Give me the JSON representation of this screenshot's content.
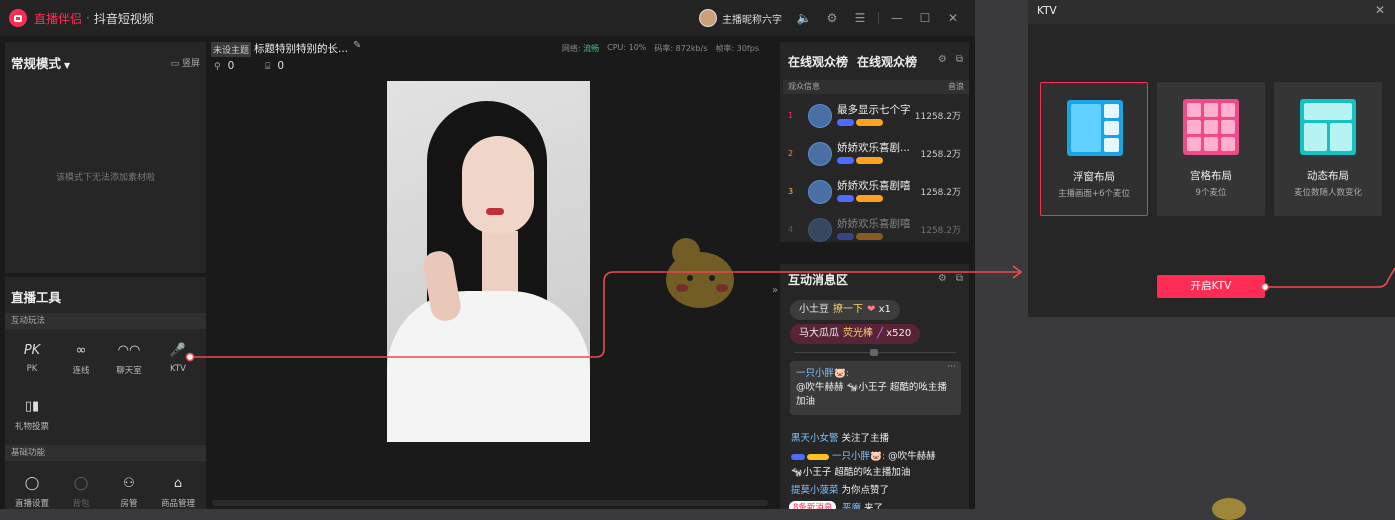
{
  "titlebar": {
    "brand": "直播伴侣",
    "sep": "·",
    "subtitle": "抖音短视频",
    "host_name": "主播昵称六字"
  },
  "left": {
    "mode_title": "常规模式",
    "screen_btn": "竖屏",
    "empty_msg": "该模式下无法添加素材啦",
    "tools_title": "直播工具",
    "sec_interactive": "互动玩法",
    "sec_basic": "基础功能",
    "tools": {
      "pk": "PK",
      "link": "连线",
      "chat": "聊天室",
      "ktv": "KTV",
      "vote": "礼物投票",
      "settings": "直播设置",
      "bag": "背包",
      "admin": "房管",
      "goods": "商品管理"
    }
  },
  "stream": {
    "tag": "未设主题",
    "title": "标题特别特别的长...",
    "net_label": "网络:",
    "net_value": "流畅",
    "cpu": "CPU: 10%",
    "bitrate": "码率: 872kb/s",
    "fps": "帧率: 30fps",
    "viewers": "0",
    "gifts": "0"
  },
  "audience": {
    "tab1": "在线观众榜",
    "tab2": "在线观众榜",
    "col_info": "观众信息",
    "col_val": "音浪",
    "rows": [
      {
        "rank": "1",
        "name": "最多显示七个字",
        "value": "11258.2万",
        "rank_color": "#fe2c55"
      },
      {
        "rank": "2",
        "name": "娇娇欢乐喜剧...",
        "value": "1258.2万",
        "rank_color": "#ff8a2a"
      },
      {
        "rank": "3",
        "name": "娇娇欢乐喜剧嘻",
        "value": "1258.2万",
        "rank_color": "#ffc020"
      },
      {
        "rank": "4",
        "name": "娇娇欢乐喜剧嘻",
        "value": "1258.2万",
        "rank_color": "#999999"
      }
    ]
  },
  "messages": {
    "title": "互动消息区",
    "gift1": {
      "user": "小土豆",
      "action": "撩一下",
      "count": "x1"
    },
    "gift2": {
      "user": "马大瓜瓜",
      "action": "荧光棒",
      "count": "x520"
    },
    "bubble_user": "一只小胖🐷:",
    "bubble_text": "@吹牛赫赫 🐄小王子 超酷的吆主播加油",
    "feed": [
      {
        "user": "黑天小女警",
        "text": "关注了主播"
      },
      {
        "user": "一只小胖🐷:",
        "text": "@吹牛赫赫"
      },
      {
        "user": "",
        "text": "🐄小王子  超酷的吆主播加油"
      },
      {
        "user": "提莫小菠菜",
        "text": "为你点赞了"
      },
      {
        "user": "恶魔",
        "text": "来了"
      }
    ],
    "new_msgs": "8条新消息"
  },
  "ktv": {
    "title": "KTV",
    "layouts": [
      {
        "name": "浮窗布局",
        "desc": "主播画面+6个麦位"
      },
      {
        "name": "宫格布局",
        "desc": "9个麦位"
      },
      {
        "name": "动态布局",
        "desc": "麦位数随人数变化"
      }
    ],
    "start": "开启KTV"
  },
  "colors": {
    "accent": "#fe2c55",
    "ok": "#3ec47c"
  }
}
